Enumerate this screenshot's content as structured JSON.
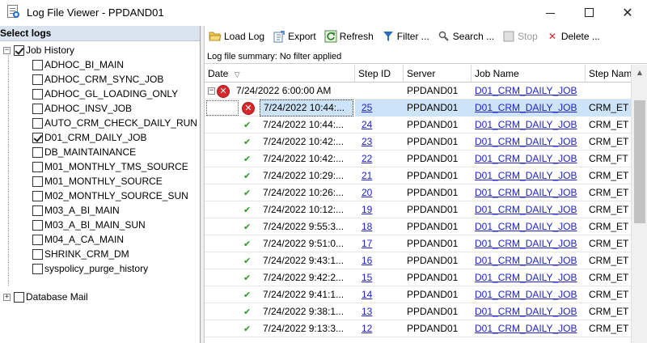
{
  "window": {
    "title": "Log File Viewer - PPDAND01",
    "minimize": "minimize",
    "maximize": "maximize",
    "close": "✕"
  },
  "left": {
    "header": "Select logs",
    "job_history_label": "Job History",
    "jobs": [
      {
        "label": "ADHOC_BI_MAIN",
        "checked": false
      },
      {
        "label": "ADHOC_CRM_SYNC_JOB",
        "checked": false
      },
      {
        "label": "ADHOC_GL_LOADING_ONLY",
        "checked": false
      },
      {
        "label": "ADHOC_INSV_JOB",
        "checked": false
      },
      {
        "label": "AUTO_CRM_CHECK_DAILY_RUN",
        "checked": false
      },
      {
        "label": "D01_CRM_DAILY_JOB",
        "checked": true
      },
      {
        "label": "DB_MAINTAINANCE",
        "checked": false
      },
      {
        "label": "M01_MONTHLY_TMS_SOURCE",
        "checked": false
      },
      {
        "label": "M01_MONTHLY_SOURCE",
        "checked": false
      },
      {
        "label": "M02_MONTHLY_SOURCE_SUN",
        "checked": false
      },
      {
        "label": "M03_A_BI_MAIN",
        "checked": false
      },
      {
        "label": "M03_A_BI_MAIN_SUN",
        "checked": false
      },
      {
        "label": "M04_A_CA_MAIN",
        "checked": false
      },
      {
        "label": "SHRINK_CRM_DM",
        "checked": false
      },
      {
        "label": "syspolicy_purge_history",
        "checked": false
      }
    ],
    "database_mail_label": "Database Mail"
  },
  "toolbar": {
    "load_log": "Load Log",
    "export": "Export",
    "refresh": "Refresh",
    "filter": "Filter ...",
    "search": "Search ...",
    "stop": "Stop",
    "delete": "Delete ..."
  },
  "summary": "Log file summary: No filter applied",
  "grid": {
    "columns": [
      "Date",
      "Step ID",
      "Server",
      "Job Name",
      "Step Nam"
    ],
    "group_row": {
      "date": "7/24/2022 6:00:00 AM",
      "server": "PPDAND01",
      "job": "D01_CRM_DAILY_JOB"
    },
    "rows": [
      {
        "status": "error",
        "date": "7/24/2022 10:44:...",
        "step": "25",
        "server": "PPDAND01",
        "job": "D01_CRM_DAILY_JOB",
        "step_name": "CRM_ET",
        "selected": true
      },
      {
        "status": "success",
        "date": "7/24/2022 10:44:...",
        "step": "24",
        "server": "PPDAND01",
        "job": "D01_CRM_DAILY_JOB",
        "step_name": "CRM_ET"
      },
      {
        "status": "success",
        "date": "7/24/2022 10:42:...",
        "step": "23",
        "server": "PPDAND01",
        "job": "D01_CRM_DAILY_JOB",
        "step_name": "CRM_ET"
      },
      {
        "status": "success",
        "date": "7/24/2022 10:42:...",
        "step": "22",
        "server": "PPDAND01",
        "job": "D01_CRM_DAILY_JOB",
        "step_name": "CRM_FT"
      },
      {
        "status": "success",
        "date": "7/24/2022 10:29:...",
        "step": "21",
        "server": "PPDAND01",
        "job": "D01_CRM_DAILY_JOB",
        "step_name": "CRM_ET"
      },
      {
        "status": "success",
        "date": "7/24/2022 10:26:...",
        "step": "20",
        "server": "PPDAND01",
        "job": "D01_CRM_DAILY_JOB",
        "step_name": "CRM_ET"
      },
      {
        "status": "success",
        "date": "7/24/2022 10:12:...",
        "step": "19",
        "server": "PPDAND01",
        "job": "D01_CRM_DAILY_JOB",
        "step_name": "CRM_ET"
      },
      {
        "status": "success",
        "date": "7/24/2022 9:55:3...",
        "step": "18",
        "server": "PPDAND01",
        "job": "D01_CRM_DAILY_JOB",
        "step_name": "CRM_ET"
      },
      {
        "status": "success",
        "date": "7/24/2022 9:51:0...",
        "step": "17",
        "server": "PPDAND01",
        "job": "D01_CRM_DAILY_JOB",
        "step_name": "CRM_ET"
      },
      {
        "status": "success",
        "date": "7/24/2022 9:43:1...",
        "step": "16",
        "server": "PPDAND01",
        "job": "D01_CRM_DAILY_JOB",
        "step_name": "CRM_ET"
      },
      {
        "status": "success",
        "date": "7/24/2022 9:42:2...",
        "step": "15",
        "server": "PPDAND01",
        "job": "D01_CRM_DAILY_JOB",
        "step_name": "CRM_ET"
      },
      {
        "status": "success",
        "date": "7/24/2022 9:41:1...",
        "step": "14",
        "server": "PPDAND01",
        "job": "D01_CRM_DAILY_JOB",
        "step_name": "CRM_ET"
      },
      {
        "status": "success",
        "date": "7/24/2022 9:38:1...",
        "step": "13",
        "server": "PPDAND01",
        "job": "D01_CRM_DAILY_JOB",
        "step_name": "CRM_ET"
      },
      {
        "status": "success",
        "date": "7/24/2022 9:13:3...",
        "step": "12",
        "server": "PPDAND01",
        "job": "D01_CRM_DAILY_JOB",
        "step_name": "CRM_ET"
      }
    ]
  },
  "colors": {
    "header_bg": "#d9e4f0",
    "selected_bg": "#cde3f7",
    "link": "#1f23c8",
    "success": "#2a9a2a",
    "error": "#d8262a"
  }
}
